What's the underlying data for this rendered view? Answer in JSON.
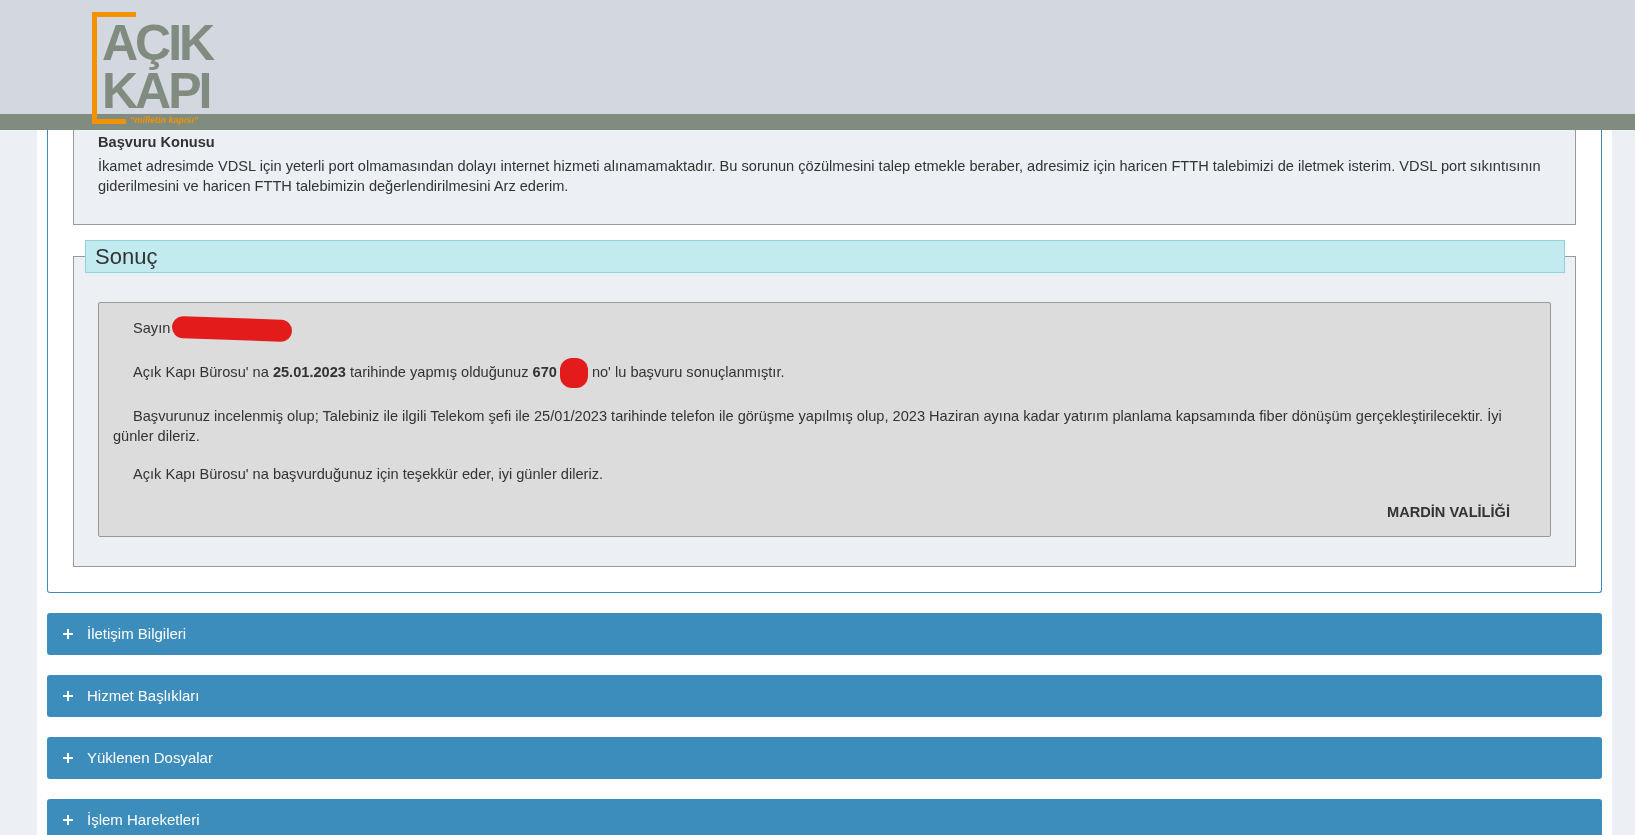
{
  "logo": {
    "line_1": "AÇIK",
    "line_2": "KAPI",
    "tagline": "“milletin kapısı”"
  },
  "subject": {
    "title": "Başvuru Konusu",
    "text": "İkamet adresimde VDSL için yeterli port olmamasından dolayı internet hizmeti alınamamaktadır. Bu sorunun çözülmesini talep etmekle beraber, adresimiz için haricen FTTH talebimizi de iletmek isterim. VDSL port sıkıntısının giderilmesini ve haricen FTTH talebimizin değerlendirilmesini Arz ederim."
  },
  "result": {
    "legend": "Sonuç",
    "greeting": "Sayın",
    "paragraphs": [
      {
        "before": "Açık Kapı Bürosu' na **25.01.2023** tarihinde yapmış olduğunuz **670**",
        "redacted": true,
        "after": "no' lu başvuru sonuçlanmıştır."
      },
      {
        "before": "Başvurunuz incelenmiş olup; Talebiniz ile ilgili Telekom şefi ile 25/01/2023 tarihinde telefon ile görüşme yapılmış olup, 2023 Haziran ayına kadar yatırım planlama kapsamında fiber dönüşüm gerçekleştirilecektir. İyi günler dileriz.",
        "redacted": false
      },
      {
        "before": "Açık Kapı Bürosu' na başvurduğunuz için teşekkür eder, iyi günler dileriz.",
        "redacted": false
      }
    ],
    "signature": "MARDİN VALİLİĞİ"
  },
  "sections": [
    {
      "label": "İletişim Bilgileri",
      "expanded": false
    },
    {
      "label": "Hizmet Başlıkları",
      "expanded": false
    },
    {
      "label": "Yüklenen Dosyalar",
      "expanded": false
    },
    {
      "label": "İşlem Hareketleri",
      "expanded": false
    }
  ]
}
